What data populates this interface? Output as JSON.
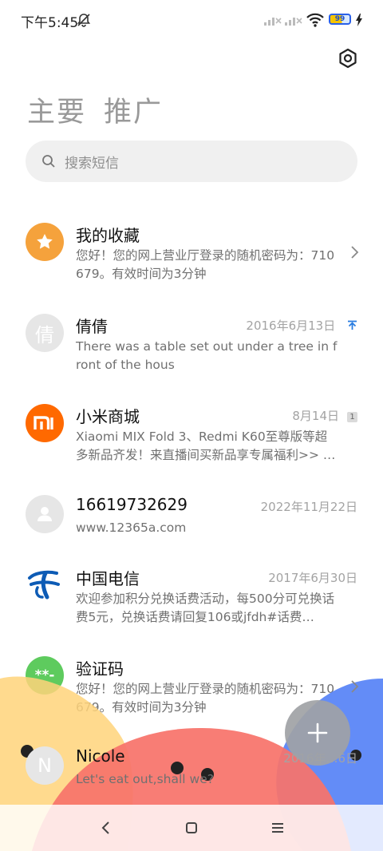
{
  "status_bar": {
    "time": "下午5:45",
    "battery_level": "99",
    "icons": [
      "mute-bell-icon",
      "signal-icon",
      "signal-icon",
      "wifi-icon",
      "battery-icon",
      "charging-bolt-icon"
    ]
  },
  "header": {
    "tabs": [
      {
        "label": "主要"
      },
      {
        "label": "推广"
      }
    ],
    "settings_icon": "gear-icon"
  },
  "search": {
    "placeholder": "搜索短信"
  },
  "messages": [
    {
      "sender": "我的收藏",
      "date": "",
      "preview": "您好！您的网上营业厅登录的随机密码为：710679。有效时间为3分钟",
      "avatar": {
        "type": "icon",
        "icon": "star-icon",
        "color": "#f5a23c"
      },
      "trailing": "chevron"
    },
    {
      "sender": "倩倩",
      "date": "2016年6月13日",
      "preview": "There was a table set out under a tree in front of the hous",
      "avatar": {
        "type": "text",
        "text": "倩",
        "color": "#e6e6e6"
      },
      "trailing": "pin"
    },
    {
      "sender": "小米商城",
      "date": "8月14日",
      "badge": "1",
      "preview": "Xiaomi MIX Fold 3、Redmi K60至尊版等超多新品齐发！来直播间买新品享专属福利>> …",
      "avatar": {
        "type": "logo",
        "icon": "mi-logo-icon",
        "color": "#ff6900"
      }
    },
    {
      "sender": "16619732629",
      "date": "2022年11月22日",
      "preview": "www.12365a.com",
      "avatar": {
        "type": "icon",
        "icon": "person-icon",
        "color": "#e6e6e6"
      }
    },
    {
      "sender": "中国电信",
      "date": "2017年6月30日",
      "preview": "欢迎参加积分兑换话费活动，每500分可兑换话费5元，兑换话费请回复106或jfdh#话费…",
      "avatar": {
        "type": "logo",
        "icon": "china-telecom-logo-icon",
        "color": "#0d5bb5"
      }
    },
    {
      "sender": "验证码",
      "date": "",
      "preview": "您好！您的网上营业厅登录的随机密码为：710679。有效时间为3分钟",
      "avatar": {
        "type": "text",
        "text": "**-",
        "color": "#5ecb5e"
      },
      "trailing": "chevron"
    },
    {
      "sender": "Nicole",
      "date": "2016年…6日",
      "preview": "Let's eat out,shall we?",
      "avatar": {
        "type": "text",
        "text": "N",
        "color": "#e6e6e6"
      }
    }
  ],
  "fab": {
    "icon": "plus-icon"
  },
  "navbar": {
    "icons": [
      "back-icon",
      "home-icon",
      "recents-icon"
    ]
  },
  "colors": {
    "accent_blue": "#2a7de1",
    "deco_yellow": "#ffd37a",
    "deco_red": "#f8736b",
    "deco_blue": "#5b86f7"
  }
}
